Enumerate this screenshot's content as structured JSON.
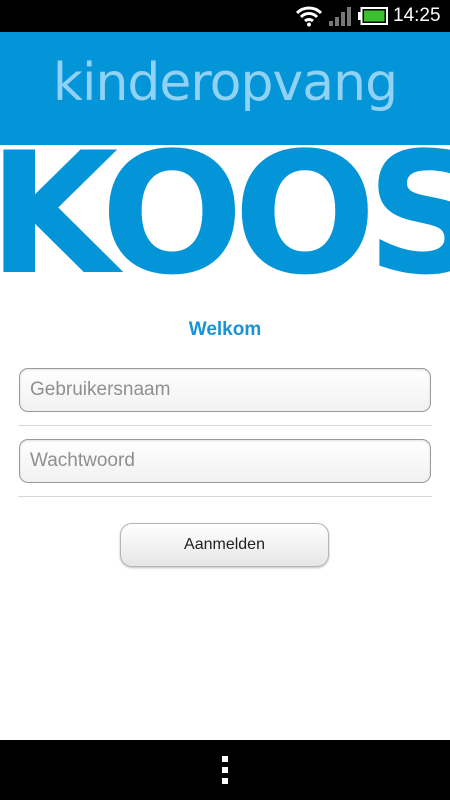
{
  "status_bar": {
    "time": "14:25",
    "icons": [
      "wifi-icon",
      "signal-icon",
      "battery-icon"
    ],
    "battery_color": "#3bbf2e"
  },
  "header": {
    "brand_text": "kinderopvang",
    "background_color": "#0494d8",
    "text_color": "#8fd2f4"
  },
  "logo": {
    "text": "KOOS",
    "color": "#0494d8"
  },
  "login": {
    "welcome": "Welkom",
    "username_placeholder": "Gebruikersnaam",
    "username_value": "",
    "password_placeholder": "Wachtwoord",
    "password_value": "",
    "submit_label": "Aanmelden",
    "accent_color": "#1a93d6"
  },
  "nav_bar": {
    "icons": [
      "menu-icon"
    ]
  }
}
